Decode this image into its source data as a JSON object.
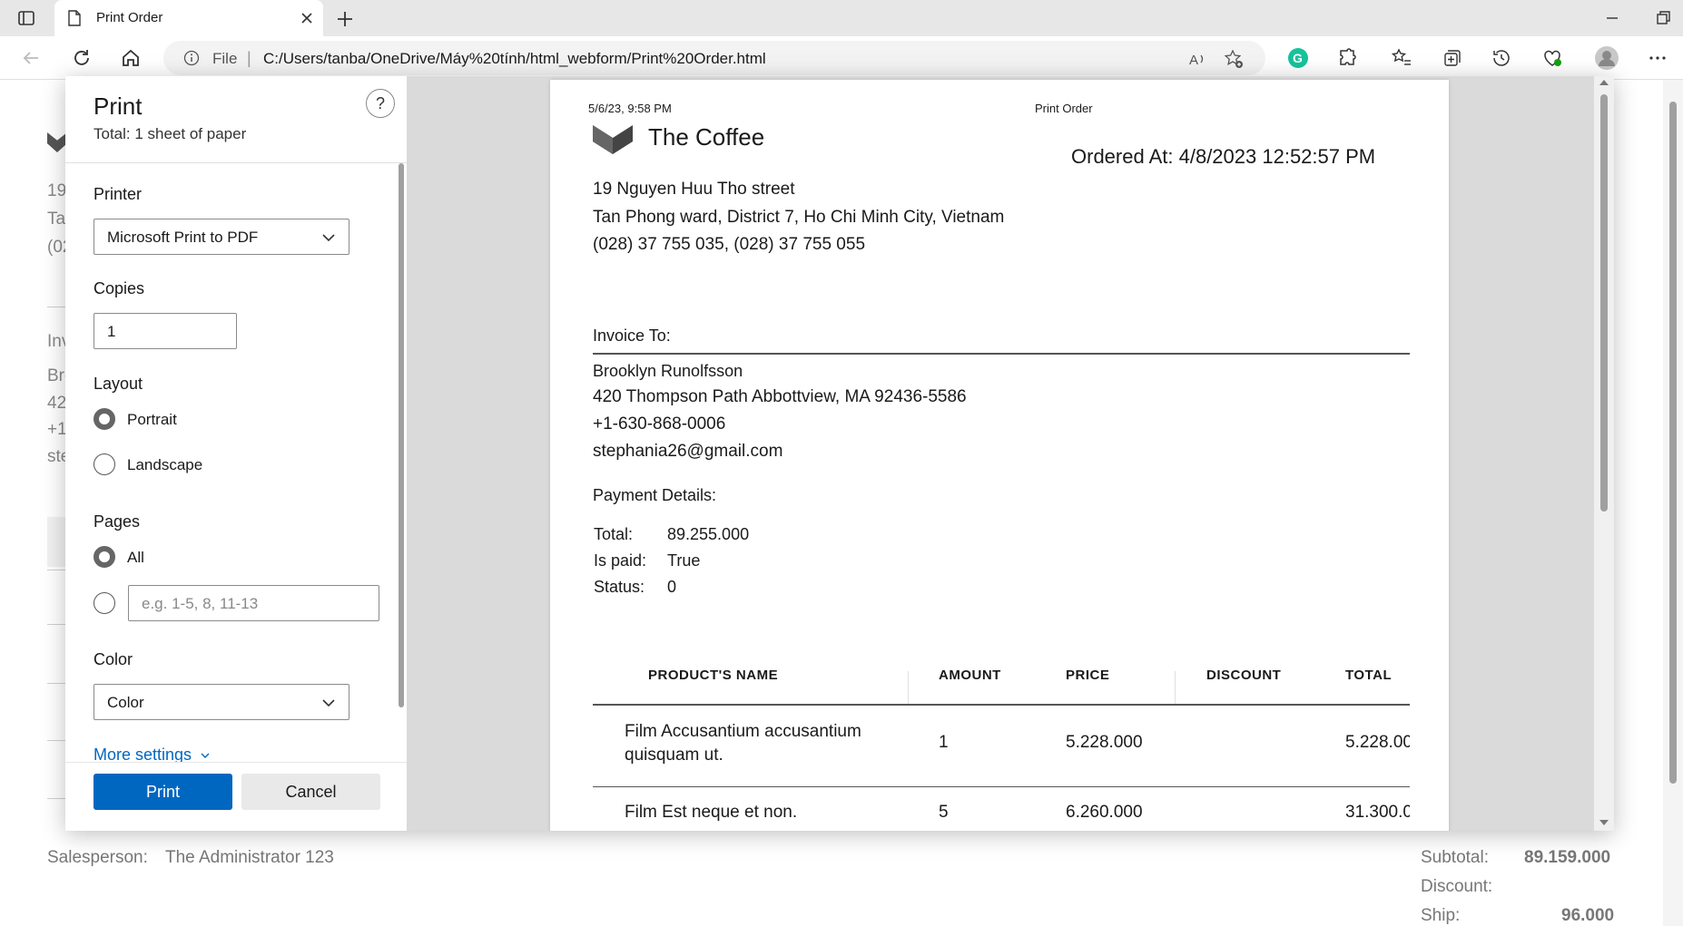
{
  "browser": {
    "tab_title": "Print Order",
    "address_scheme": "File",
    "address_url": "C:/Users/tanba/OneDrive/Máy%20tính/html_webform/Print%20Order.html"
  },
  "background_page": {
    "fragments": [
      "19",
      "Ta",
      "(02",
      "Inv",
      "Bro",
      "42",
      "+1",
      "ste"
    ],
    "salesperson_label": "Salesperson:",
    "salesperson_value": "The Administrator 123",
    "subtotal_label": "Subtotal:",
    "subtotal_value": "89.159.000",
    "discount_label": "Discount:",
    "ship_label": "Ship:",
    "ship_value": "96.000"
  },
  "print_panel": {
    "title": "Print",
    "subtitle": "Total: 1 sheet of paper",
    "help": "?",
    "printer_label": "Printer",
    "printer_value": "Microsoft Print to PDF",
    "copies_label": "Copies",
    "copies_value": "1",
    "layout_label": "Layout",
    "layout_portrait": "Portrait",
    "layout_landscape": "Landscape",
    "pages_label": "Pages",
    "pages_all": "All",
    "pages_placeholder": "e.g. 1-5, 8, 11-13",
    "color_label": "Color",
    "color_value": "Color",
    "more_settings": "More settings",
    "print_button": "Print",
    "cancel_button": "Cancel"
  },
  "sheet": {
    "print_date": "5/6/23, 9:58 PM",
    "print_title": "Print Order",
    "shop_name": "The Coffee",
    "ordered_at": "Ordered At: 4/8/2023 12:52:57 PM",
    "address_line1": "19 Nguyen Huu Tho street",
    "address_line2": "Tan Phong ward, District 7, Ho Chi Minh City, Vietnam",
    "phones": "(028) 37 755 035, (028) 37 755 055",
    "invoice_to_label": "Invoice To:",
    "customer_name": "Brooklyn Runolfsson",
    "customer_address": "420 Thompson Path Abbottview, MA 92436-5586",
    "customer_phone": "+1-630-868-0006",
    "customer_email": "stephania26@gmail.com",
    "payment_label": "Payment Details:",
    "total_label": "Total:",
    "total_value": "89.255.000",
    "paid_label": "Is paid:",
    "paid_value": "True",
    "status_label": "Status:",
    "status_value": "0",
    "table": {
      "headers": [
        "PRODUCT'S NAME",
        "AMOUNT",
        "PRICE",
        "DISCOUNT",
        "TOTAL"
      ],
      "rows": [
        {
          "name_line1": "Film Accusantium accusantium",
          "name_line2": "quisquam ut.",
          "amount": "1",
          "price": "5.228.000",
          "discount": "",
          "total": "5.228.00"
        },
        {
          "name_line1": "Film Est neque et non.",
          "name_line2": "",
          "amount": "5",
          "price": "6.260.000",
          "discount": "",
          "total": "31.300.0"
        }
      ]
    }
  },
  "colors": {
    "accent": "#0067c0",
    "tab_strip": "#e7e7e7",
    "preview_bg": "#dadada"
  }
}
